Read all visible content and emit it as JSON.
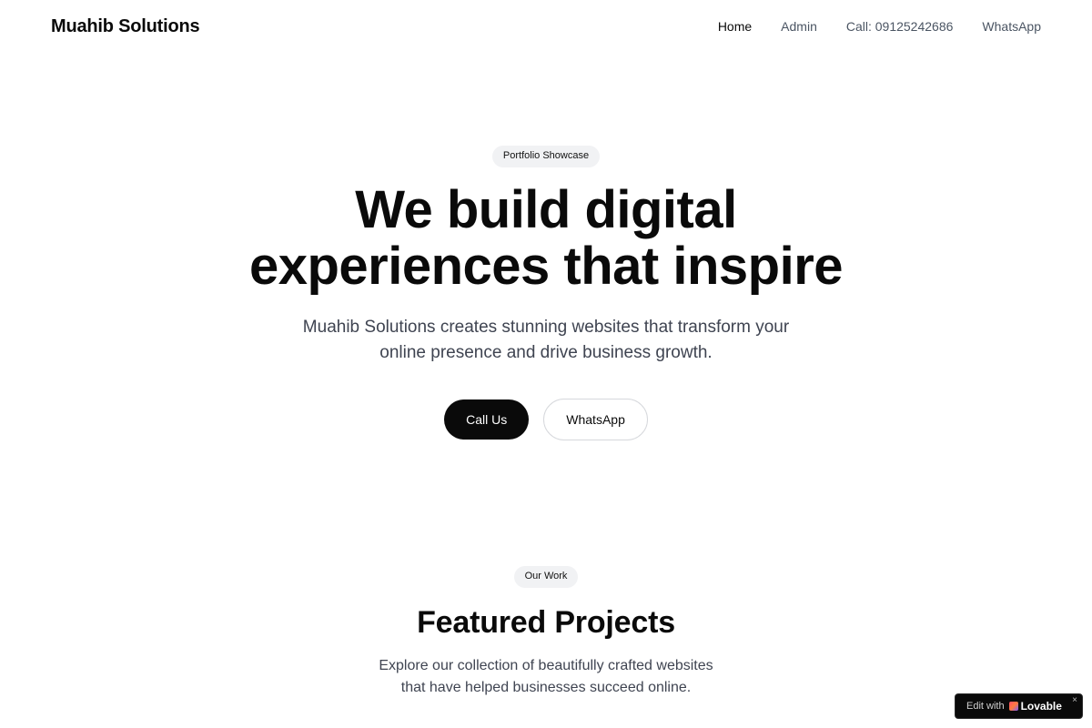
{
  "header": {
    "brand": "Muahib Solutions",
    "nav": [
      {
        "label": "Home",
        "active": true
      },
      {
        "label": "Admin",
        "active": false
      },
      {
        "label": "Call: 09125242686",
        "active": false
      },
      {
        "label": "WhatsApp",
        "active": false
      }
    ]
  },
  "hero": {
    "pill": "Portfolio Showcase",
    "title_line1": "We build digital",
    "title_line2": "experiences that inspire",
    "subtitle": "Muahib Solutions creates stunning websites that transform your online presence and drive business growth.",
    "primary_button": "Call Us",
    "secondary_button": "WhatsApp"
  },
  "featured": {
    "pill": "Our Work",
    "title": "Featured Projects",
    "subtitle": "Explore our collection of beautifully crafted websites that have helped businesses succeed online."
  },
  "badge": {
    "prefix": "Edit with",
    "brand": "Lovable",
    "close": "×"
  },
  "colors": {
    "primary": "#0a0a0a",
    "muted_text": "#3f4451",
    "pill_bg": "#f1f2f4",
    "border": "#d6d8dc"
  }
}
